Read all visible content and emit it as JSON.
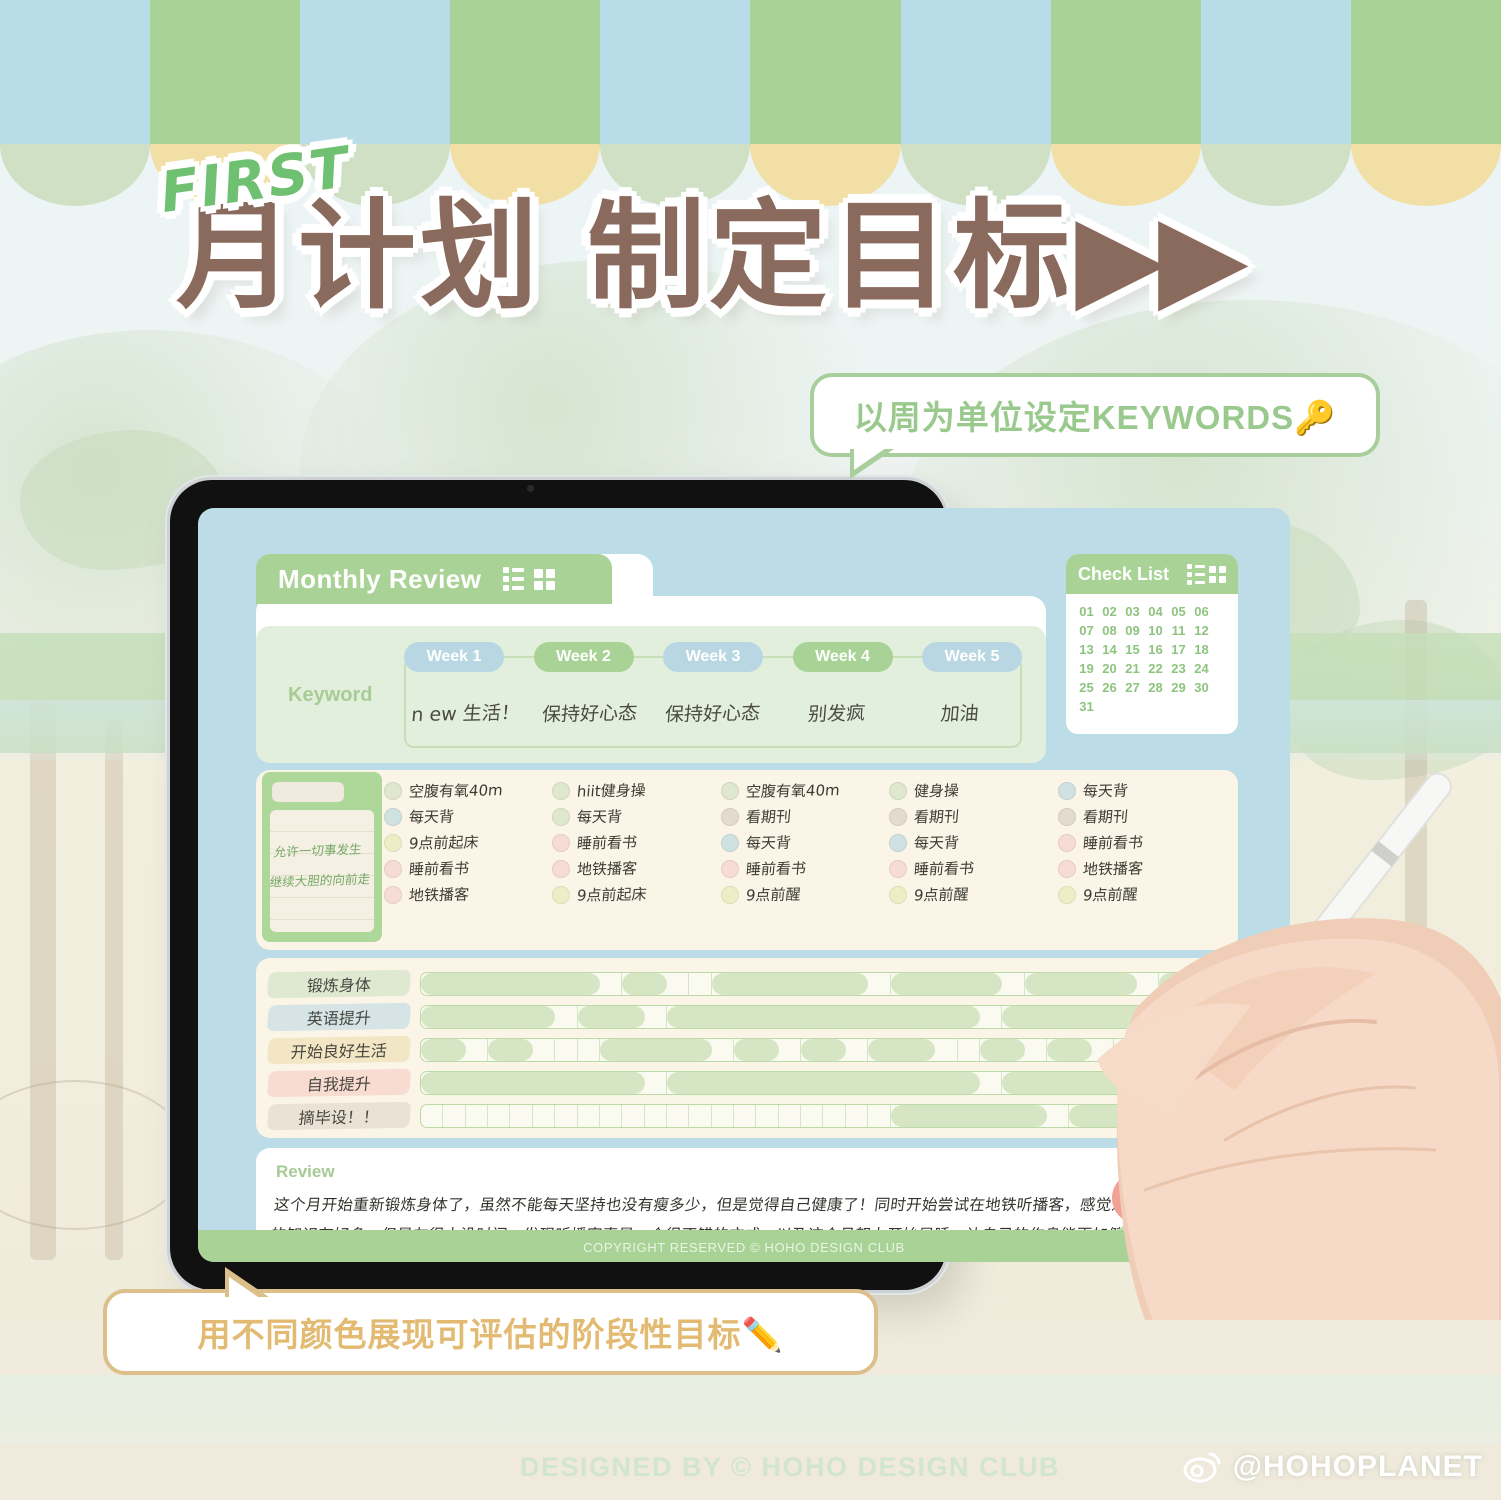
{
  "badge": {
    "first": "FIRST"
  },
  "headline": {
    "text": "月计划 制定目标",
    "arrows": "▶▶"
  },
  "bubbles": {
    "top": "以周为单位设定KEYWORDS🔑",
    "bottom": "用不同颜色展现可评估的阶段性目标✏️"
  },
  "app": {
    "tab_title": "Monthly Review",
    "keyword_label": "Keyword",
    "weeks": [
      {
        "label": "Week 1",
        "color": "#b9d7e3",
        "keyword": "n ew 生活！"
      },
      {
        "label": "Week 2",
        "color": "#a9d396",
        "keyword": "保持好心态"
      },
      {
        "label": "Week 3",
        "color": "#b9d7e3",
        "keyword": "保持好心态"
      },
      {
        "label": "Week 4",
        "color": "#a9d396",
        "keyword": "别发疯"
      },
      {
        "label": "Week 5",
        "color": "#b9d7e3",
        "keyword": "加油"
      }
    ],
    "checklist": {
      "title": "Check List",
      "days": [
        "01",
        "02",
        "03",
        "04",
        "05",
        "06",
        "07",
        "08",
        "09",
        "10",
        "11",
        "12",
        "13",
        "14",
        "15",
        "16",
        "17",
        "18",
        "19",
        "20",
        "21",
        "22",
        "23",
        "24",
        "25",
        "26",
        "27",
        "28",
        "29",
        "30",
        "31"
      ]
    },
    "note": {
      "lines": [
        "允许一切事发生",
        "继续大胆的向前走"
      ]
    },
    "habit_columns": [
      {
        "items": [
          {
            "text": "空腹有氧40m",
            "color": "#dfe7cf"
          },
          {
            "text": "每天背",
            "color": "#cfe1e0"
          },
          {
            "text": "9点前起床",
            "color": "#eeeec6"
          },
          {
            "text": "睡前看书",
            "color": "#f6dcd4"
          },
          {
            "text": "地铁播客",
            "color": "#f6dcd4"
          }
        ]
      },
      {
        "items": [
          {
            "text": "hiit健身操",
            "color": "#dfe7cf"
          },
          {
            "text": "每天背",
            "color": "#dfe7cf"
          },
          {
            "text": "睡前看书",
            "color": "#f6dcd4"
          },
          {
            "text": "地铁播客",
            "color": "#f6dcd4"
          },
          {
            "text": "9点前起床",
            "color": "#eeeec6"
          }
        ]
      },
      {
        "items": [
          {
            "text": "空腹有氧40m",
            "color": "#dfe7cf"
          },
          {
            "text": "看期刊",
            "color": "#e3dbcd"
          },
          {
            "text": "每天背",
            "color": "#cfe1e0"
          },
          {
            "text": "睡前看书",
            "color": "#f6dcd4"
          },
          {
            "text": "9点前醒",
            "color": "#eeeec6"
          }
        ]
      },
      {
        "items": [
          {
            "text": "健身操",
            "color": "#dfe7cf"
          },
          {
            "text": "看期刊",
            "color": "#e3dbcd"
          },
          {
            "text": "每天背",
            "color": "#cfe1e0"
          },
          {
            "text": "睡前看书",
            "color": "#f6dcd4"
          },
          {
            "text": "9点前醒",
            "color": "#eeeec6"
          }
        ]
      },
      {
        "items": [
          {
            "text": "每天背",
            "color": "#cfe1e0"
          },
          {
            "text": "看期刊",
            "color": "#e3dbcd"
          },
          {
            "text": "睡前看书",
            "color": "#f6dcd4"
          },
          {
            "text": "地铁播客",
            "color": "#f6dcd4"
          },
          {
            "text": "9点前醒",
            "color": "#eeeec6"
          }
        ]
      }
    ],
    "goals": [
      {
        "label": "锻炼身体",
        "chip_color": "#dfe9d2",
        "cells": 31,
        "filled": [
          0,
          1,
          2,
          3,
          4,
          5,
          6,
          7,
          9,
          10,
          13,
          14,
          15,
          16,
          17,
          18,
          19,
          21,
          22,
          23,
          24,
          25,
          27,
          28,
          29,
          30,
          31,
          33,
          34,
          35
        ]
      },
      {
        "label": "英语提升",
        "chip_color": "#d6e4e6",
        "cells": 31,
        "filled": [
          0,
          1,
          2,
          3,
          4,
          5,
          7,
          8,
          9,
          11,
          12,
          13,
          14,
          15,
          16,
          17,
          18,
          19,
          20,
          21,
          22,
          23,
          24,
          26,
          27,
          28,
          29,
          30,
          31,
          32,
          33
        ]
      },
      {
        "label": "开始良好生活",
        "chip_color": "#f2e6c4",
        "cells": 31,
        "filled": [
          0,
          1,
          3,
          4,
          8,
          9,
          10,
          11,
          12,
          14,
          15,
          17,
          18,
          20,
          21,
          22,
          25,
          26,
          28,
          29,
          32,
          33,
          34
        ]
      },
      {
        "label": "自我提升",
        "chip_color": "#f8dcd2",
        "cells": 31,
        "filled": [
          0,
          1,
          2,
          3,
          4,
          5,
          6,
          7,
          8,
          9,
          11,
          12,
          13,
          14,
          15,
          16,
          17,
          18,
          19,
          20,
          21,
          22,
          23,
          24,
          26,
          27,
          28,
          29,
          30,
          31,
          32
        ]
      },
      {
        "label": "摘毕设！！",
        "chip_color": "#eae2d5",
        "cells": 31,
        "filled": [
          21,
          22,
          23,
          24,
          25,
          26,
          27,
          29,
          30,
          31,
          32,
          33,
          34
        ]
      }
    ],
    "review": {
      "label": "Review",
      "text": "这个月开始重新锻炼身体了，虽然不能每天坚持也没有瘦多少，但是觉得自己健康了！同时开始尝试在地铁听播客，感觉近期需要急补的知识有好多，但是友很本没时间，发现听播客真是一个很不错的方式，以及这个月努力开始早睡，让自己的作息能更加健康一些"
    },
    "copyright": "COPYRIGHT RESERVED © HOHO DESIGN CLUB"
  },
  "footer": {
    "designed": "DESIGNED BY © HOHO DESIGN CLUB",
    "weibo_handle": "@HOHOPLANET"
  },
  "awning": {
    "stripe_colors": [
      "#b9dce9",
      "#a9d396",
      "#b9dce9",
      "#a9d396",
      "#b9dce9",
      "#a9d396",
      "#b9dce9",
      "#a9d396",
      "#b9dce9",
      "#a9d396"
    ],
    "scallop_colors": [
      "#cfe0c5",
      "#f2dfa6",
      "#cfe0c5",
      "#f2dfa6",
      "#cfe0c5",
      "#f2dfa6",
      "#cfe0c5",
      "#f2dfa6",
      "#cfe0c5",
      "#f2dfa6"
    ]
  },
  "theme": {
    "green": "#a9d396",
    "blue": "#b9d7e3",
    "brown": "#8a6a5c",
    "cream": "#faf5e6",
    "gold": "#e3ba72"
  }
}
